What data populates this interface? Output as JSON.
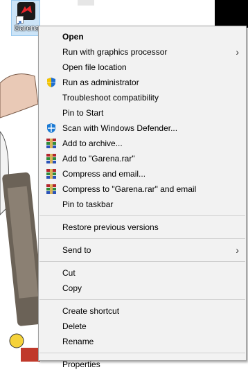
{
  "desktop": {
    "icon_label": "Garena"
  },
  "menu": {
    "open": "Open",
    "run_gpu": "Run with graphics processor",
    "open_location": "Open file location",
    "run_admin": "Run as administrator",
    "troubleshoot": "Troubleshoot compatibility",
    "pin_start": "Pin to Start",
    "scan_defender": "Scan with Windows Defender...",
    "add_archive": "Add to archive...",
    "add_rar": "Add to \"Garena.rar\"",
    "compress_email": "Compress and email...",
    "compress_rar_email": "Compress to \"Garena.rar\" and email",
    "pin_taskbar": "Pin to taskbar",
    "restore": "Restore previous versions",
    "send_to": "Send to",
    "cut": "Cut",
    "copy": "Copy",
    "create_shortcut": "Create shortcut",
    "delete": "Delete",
    "rename": "Rename",
    "properties": "Properties",
    "submenu_arrow": "›"
  },
  "colors": {
    "menu_bg": "#f2f2f2",
    "shield_blue": "#1f6fd1",
    "shield_yellow": "#f5c400",
    "winrar_red": "#b3262d",
    "winrar_green": "#2f8a3b",
    "winrar_blue": "#2b53b8"
  },
  "icons": [
    "uac-shield-icon",
    "windows-defender-icon",
    "winrar-icon"
  ]
}
